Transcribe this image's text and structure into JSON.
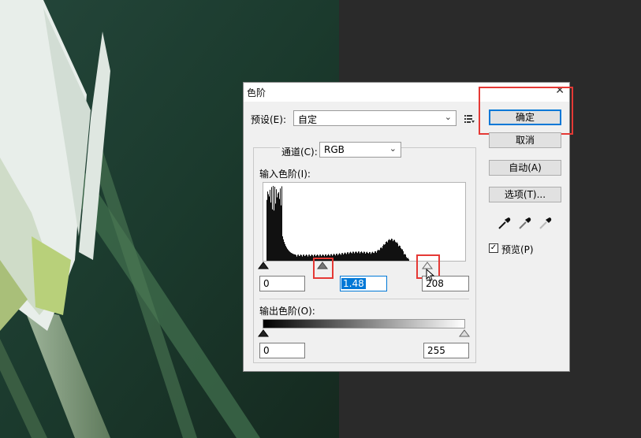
{
  "dialog": {
    "title": "色阶",
    "close_glyph": "✕",
    "preset_label": "预设(E):",
    "preset_value": "自定",
    "channel_label": "通道(C):",
    "channel_value": "RGB",
    "input_levels_label": "输入色阶(I):",
    "input_black": "0",
    "input_gamma": "1.48",
    "input_white": "208",
    "output_levels_label": "输出色阶(O):",
    "output_black": "0",
    "output_white": "255",
    "preview_label": "预览(P)",
    "preview_checked": true
  },
  "buttons": {
    "ok": "确定",
    "cancel": "取消",
    "auto": "自动(A)",
    "options": "选项(T)..."
  },
  "icons": {
    "preset_menu": "preset-menu-icon",
    "eyedroppers": [
      "black-eyedropper-icon",
      "gray-eyedropper-icon",
      "white-eyedropper-icon"
    ]
  },
  "colors": {
    "highlight": "#e53935",
    "selection": "#0078d7"
  }
}
